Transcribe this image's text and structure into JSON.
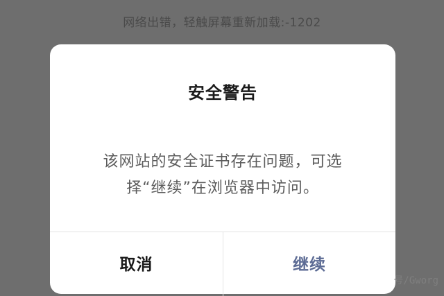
{
  "background": {
    "error_message": "网络出错，轻触屏幕重新加载:-1202"
  },
  "dialog": {
    "title": "安全警告",
    "message": "该网站的安全证书存在问题，可选\n择“继续”在浏览器中访问。",
    "buttons": {
      "cancel_label": "取消",
      "continue_label": "继续"
    }
  },
  "watermark": {
    "text": "号/Gworg"
  },
  "colors": {
    "overlay": "#6e6e6e",
    "dialog_bg": "#ffffff",
    "primary_action": "#5c6b94",
    "divider": "#e3e3e3"
  }
}
